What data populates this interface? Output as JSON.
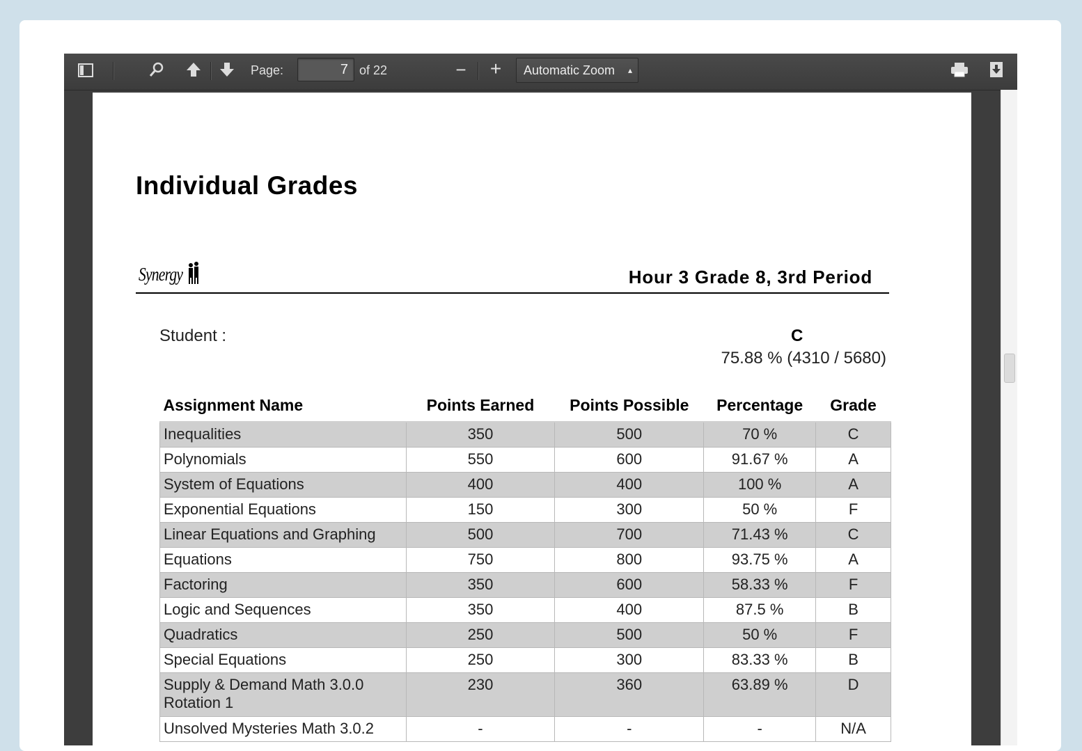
{
  "toolbar": {
    "sidebar_icon": "sidebar-toggle-icon",
    "search_icon": "search-icon",
    "prev_icon": "arrow-up-icon",
    "next_icon": "arrow-down-icon",
    "page_label": "Page:",
    "page_value": "7",
    "page_total": "of 22",
    "zoom_out": "−",
    "zoom_in": "+",
    "zoom_value": "Automatic Zoom",
    "print_icon": "print-icon",
    "download_icon": "download-icon"
  },
  "document": {
    "title": "Individual Grades",
    "logo_text": "Synergy",
    "class_title": "Hour 3 Grade 8, 3rd Period",
    "student_label": "Student :",
    "letter_grade": "C",
    "grade_summary": "75.88 % (4310 / 5680)",
    "table": {
      "headers": [
        "Assignment Name",
        "Points Earned",
        "Points Possible",
        "Percentage",
        "Grade"
      ],
      "rows": [
        [
          "Inequalities",
          "350",
          "500",
          "70 %",
          "C"
        ],
        [
          "Polynomials",
          "550",
          "600",
          "91.67 %",
          "A"
        ],
        [
          "System of Equations",
          "400",
          "400",
          "100 %",
          "A"
        ],
        [
          "Exponential Equations",
          "150",
          "300",
          "50 %",
          "F"
        ],
        [
          "Linear Equations and Graphing",
          "500",
          "700",
          "71.43 %",
          "C"
        ],
        [
          "Equations",
          "750",
          "800",
          "93.75 %",
          "A"
        ],
        [
          "Factoring",
          "350",
          "600",
          "58.33 %",
          "F"
        ],
        [
          "Logic and Sequences",
          "350",
          "400",
          "87.5 %",
          "B"
        ],
        [
          "Quadratics",
          "250",
          "500",
          "50 %",
          "F"
        ],
        [
          "Special Equations",
          "250",
          "300",
          "83.33 %",
          "B"
        ],
        [
          "Supply & Demand Math 3.0.0 Rotation 1",
          "230",
          "360",
          "63.89 %",
          "D"
        ],
        [
          "Unsolved Mysteries Math 3.0.2",
          "-",
          "-",
          "-",
          "N/A"
        ]
      ]
    }
  },
  "scroll_position": 0.4
}
